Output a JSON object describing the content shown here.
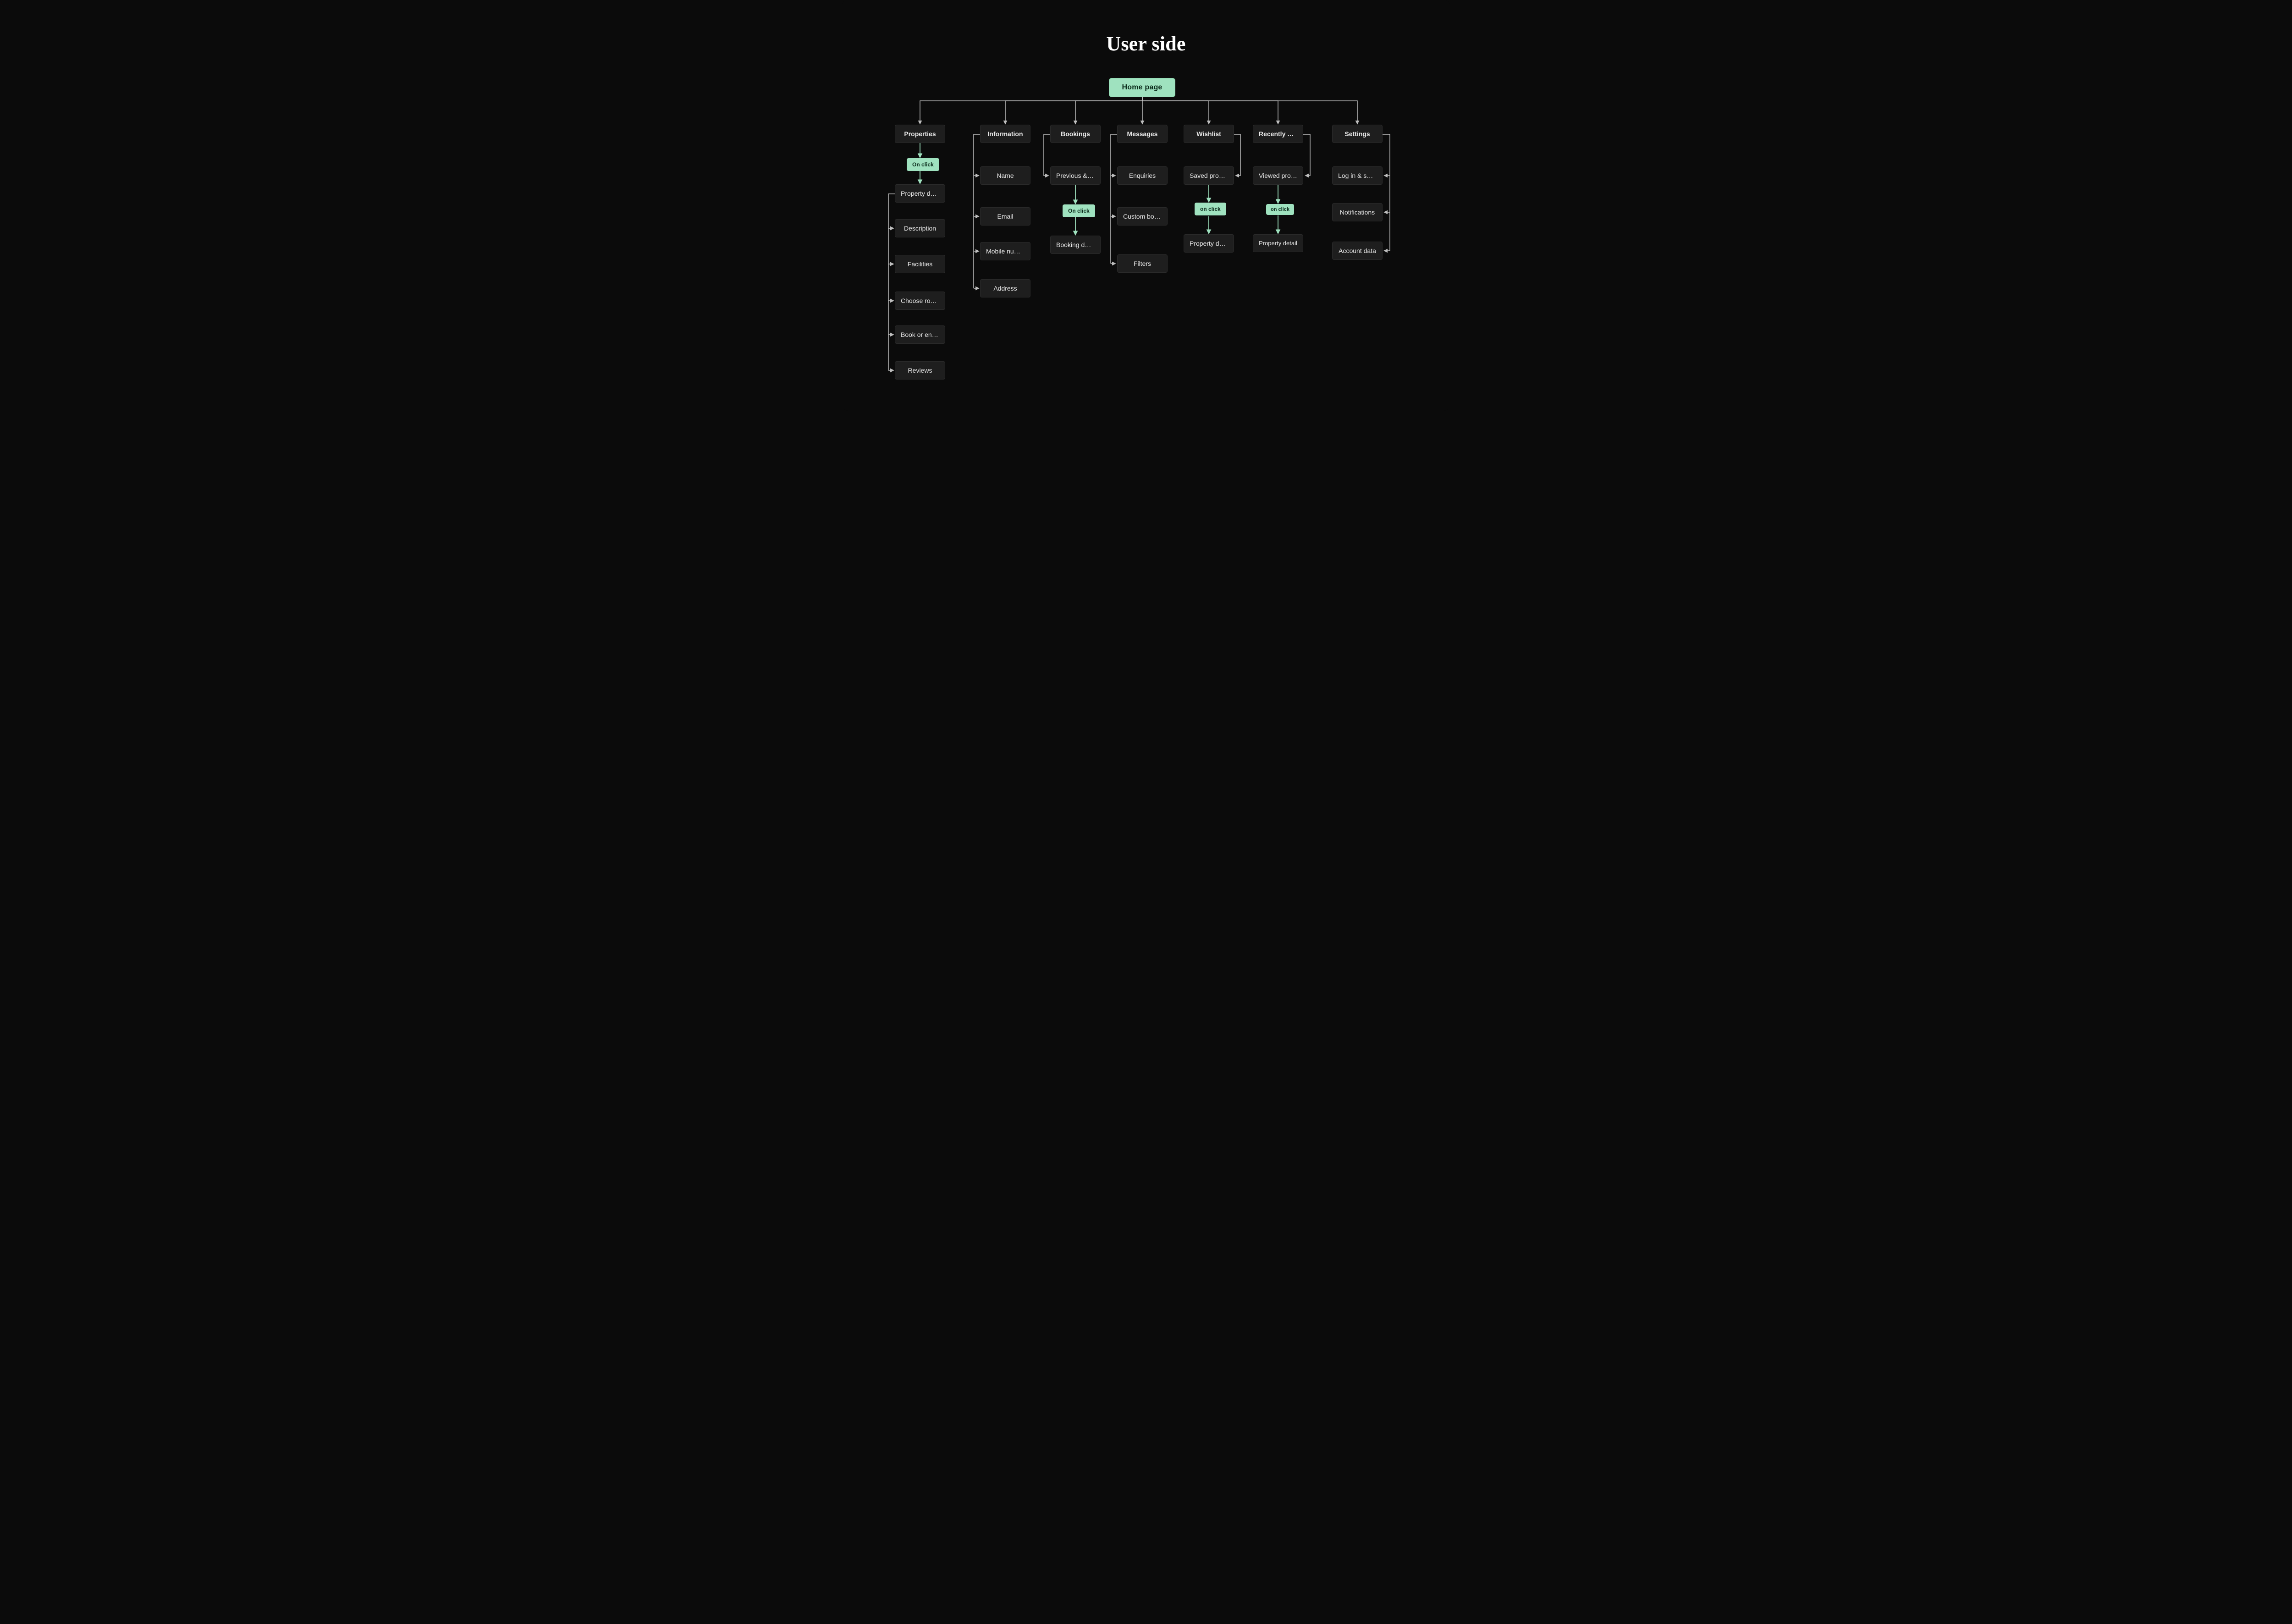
{
  "title": "User side",
  "home": "Home page",
  "columns": {
    "properties": {
      "head": "Properties",
      "badge": "On click",
      "detail": "Property detail",
      "children": [
        "Description",
        "Facilities",
        "Choose rooms",
        "Book or enqu…",
        "Reviews"
      ]
    },
    "information": {
      "head": "Information",
      "children": [
        "Name",
        "Email",
        "Mobile number",
        "Address"
      ]
    },
    "bookings": {
      "head": "Bookings",
      "item": "Previous & pr…",
      "badge": "On click",
      "detail": "Booking detail"
    },
    "messages": {
      "head": "Messages",
      "children": [
        "Enquiries",
        "Custom book…",
        "Filters"
      ]
    },
    "wishlist": {
      "head": "Wishlist",
      "item": "Saved proper…",
      "badge": "on click",
      "detail": "Property detail"
    },
    "recently": {
      "head": "Recently vie…",
      "item": "Viewed prope…",
      "badge": "on click",
      "detail": "Property detail"
    },
    "settings": {
      "head": "Settings",
      "children": [
        "Log in & secu…",
        "Notifications",
        "Account data"
      ]
    }
  }
}
